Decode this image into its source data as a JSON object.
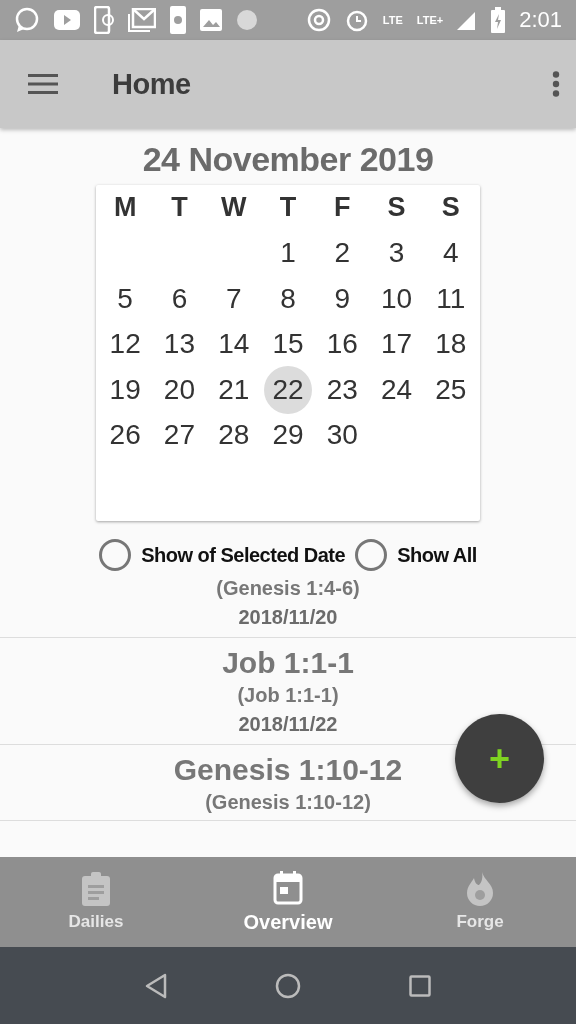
{
  "status_bar": {
    "time": "2:01",
    "network_labels": [
      "LTE",
      "LTE+"
    ]
  },
  "app_bar": {
    "title": "Home"
  },
  "date_title": "24 November 2019",
  "calendar": {
    "weekdays": [
      "M",
      "T",
      "W",
      "T",
      "F",
      "S",
      "S"
    ],
    "weeks": [
      [
        {
          "kind": "empty"
        },
        {
          "kind": "empty"
        },
        {
          "kind": "empty"
        },
        {
          "kind": "day",
          "day": "1",
          "selected": false
        },
        {
          "kind": "day",
          "day": "2",
          "selected": false
        },
        {
          "kind": "day",
          "day": "3",
          "selected": false
        },
        {
          "kind": "day",
          "day": "4",
          "selected": false
        }
      ],
      [
        {
          "kind": "day",
          "day": "5",
          "selected": false
        },
        {
          "kind": "day",
          "day": "6",
          "selected": false
        },
        {
          "kind": "day",
          "day": "7",
          "selected": false
        },
        {
          "kind": "day",
          "day": "8",
          "selected": false
        },
        {
          "kind": "day",
          "day": "9",
          "selected": false
        },
        {
          "kind": "day",
          "day": "10",
          "selected": false
        },
        {
          "kind": "day",
          "day": "11",
          "selected": false
        }
      ],
      [
        {
          "kind": "day",
          "day": "12",
          "selected": false
        },
        {
          "kind": "day",
          "day": "13",
          "selected": false
        },
        {
          "kind": "day",
          "day": "14",
          "selected": false
        },
        {
          "kind": "day",
          "day": "15",
          "selected": false
        },
        {
          "kind": "day",
          "day": "16",
          "selected": false
        },
        {
          "kind": "day",
          "day": "17",
          "selected": false
        },
        {
          "kind": "day",
          "day": "18",
          "selected": false
        }
      ],
      [
        {
          "kind": "day",
          "day": "19",
          "selected": false
        },
        {
          "kind": "day",
          "day": "20",
          "selected": false
        },
        {
          "kind": "day",
          "day": "21",
          "selected": false
        },
        {
          "kind": "day",
          "day": "22",
          "selected": true
        },
        {
          "kind": "day",
          "day": "23",
          "selected": false
        },
        {
          "kind": "day",
          "day": "24",
          "selected": false
        },
        {
          "kind": "day",
          "day": "25",
          "selected": false
        }
      ],
      [
        {
          "kind": "day",
          "day": "26",
          "selected": false
        },
        {
          "kind": "day",
          "day": "27",
          "selected": false
        },
        {
          "kind": "day",
          "day": "28",
          "selected": false
        },
        {
          "kind": "day",
          "day": "29",
          "selected": false
        },
        {
          "kind": "day",
          "day": "30",
          "selected": false
        }
      ]
    ]
  },
  "filters": [
    {
      "label": "Show of Selected Date",
      "selected": false
    },
    {
      "label": "Show All",
      "selected": false
    }
  ],
  "entries": [
    {
      "subtitle": "(Genesis 1:4-6)",
      "date": "2018/11/20"
    },
    {
      "title": "Job 1:1-1",
      "subtitle": "(Job 1:1-1)",
      "date": "2018/11/22"
    },
    {
      "title": "Genesis 1:10-12",
      "subtitle": "(Genesis 1:10-12)"
    }
  ],
  "fab": {
    "label": "+"
  },
  "bottom_nav": [
    {
      "label": "Dailies",
      "kind": "clipboard",
      "selected": false
    },
    {
      "label": "Overview",
      "kind": "calendar",
      "selected": true
    },
    {
      "label": "Forge",
      "kind": "flame",
      "selected": false
    }
  ]
}
